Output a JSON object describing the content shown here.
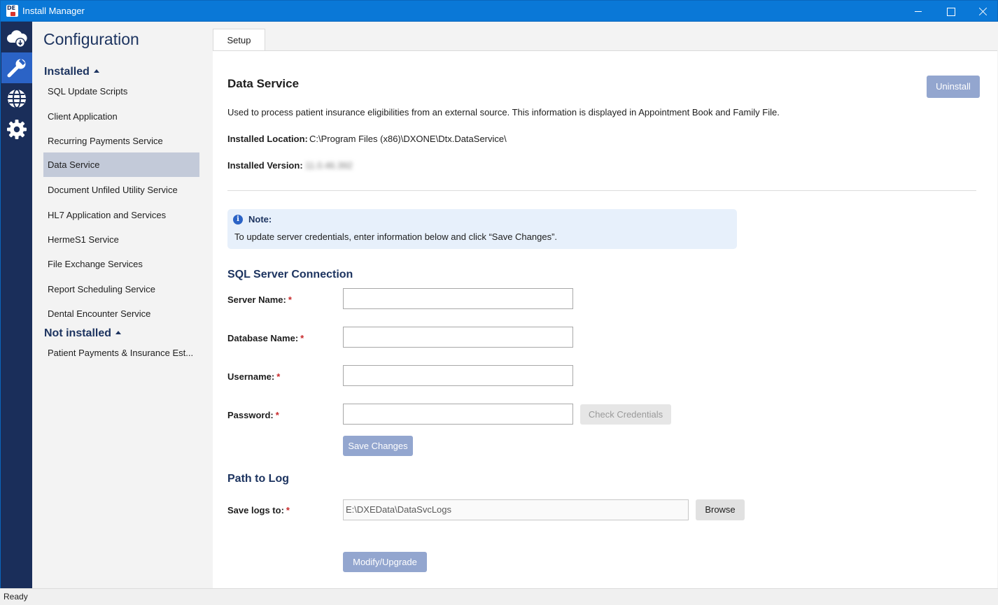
{
  "window": {
    "title": "Install Manager"
  },
  "rail": {
    "items": [
      "cloud-download-icon",
      "wrench-icon",
      "globe-icon",
      "gear-icon"
    ],
    "active_index": 1
  },
  "nav": {
    "title": "Configuration",
    "installed_label": "Installed",
    "installed_items": [
      "SQL Update Scripts",
      "Client Application",
      "Recurring Payments Service",
      "Data Service",
      "Document Unfiled Utility Service",
      "HL7 Application and Services",
      "HermeS1 Service",
      "File Exchange Services",
      "Report Scheduling Service",
      "Dental Encounter Service"
    ],
    "selected_item": "Data Service",
    "not_installed_label": "Not installed",
    "not_installed_items": [
      "Patient Payments & Insurance Est..."
    ]
  },
  "tabs": [
    "Setup"
  ],
  "service": {
    "title": "Data Service",
    "uninstall_label": "Uninstall",
    "description": "Used to process patient insurance eligibilities from an external source. This information is displayed in Appointment Book and Family File.",
    "location_label": "Installed Location:",
    "location_value": "C:\\Program Files (x86)\\DXONE\\Dtx.DataService\\",
    "version_label": "Installed Version:",
    "version_value": "11.0.46.392"
  },
  "note": {
    "title": "Note:",
    "text": "To update server credentials, enter information below and click “Save Changes”."
  },
  "sql": {
    "heading": "SQL Server Connection",
    "server_label": "Server Name:",
    "server_value": "",
    "database_label": "Database Name:",
    "database_value": "",
    "username_label": "Username:",
    "username_value": "",
    "password_label": "Password:",
    "password_value": "",
    "check_label": "Check Credentials",
    "save_label": "Save Changes"
  },
  "log": {
    "heading": "Path to Log",
    "label": "Save logs to:",
    "path": "E:\\DXEData\\DataSvcLogs",
    "browse_label": "Browse"
  },
  "modify_label": "Modify/Upgrade",
  "required_mark": "*",
  "status": {
    "text": "Ready"
  },
  "colors": {
    "titlebar": "#0a78d7",
    "rail": "#1a2e5a",
    "rail_active": "#2b63c6",
    "heading": "#1d3460",
    "primary_disabled": "#93a6cf",
    "required": "#c8292b"
  }
}
